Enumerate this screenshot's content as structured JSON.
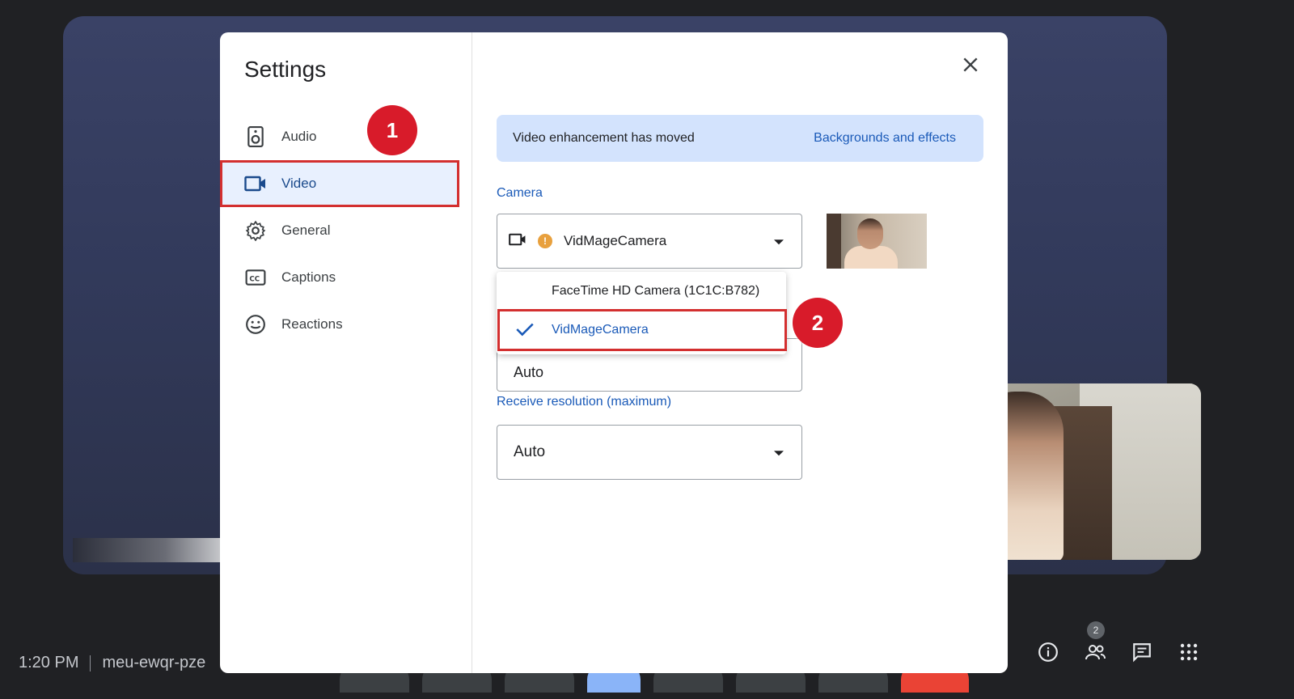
{
  "meeting": {
    "time": "1:20 PM",
    "code": "meu-ewqr-pze",
    "participant_count": "2"
  },
  "settings": {
    "title": "Settings",
    "close_icon": "close-icon",
    "nav": [
      {
        "label": "Audio",
        "icon": "speaker-icon"
      },
      {
        "label": "Video",
        "icon": "video-camera-icon",
        "active": true
      },
      {
        "label": "General",
        "icon": "gear-icon"
      },
      {
        "label": "Captions",
        "icon": "captions-icon"
      },
      {
        "label": "Reactions",
        "icon": "smiley-icon"
      }
    ],
    "banner": {
      "message": "Video enhancement has moved",
      "link": "Backgrounds and effects"
    },
    "camera": {
      "label": "Camera",
      "selected": "VidMageCamera",
      "options": [
        {
          "label": "FaceTime HD Camera (1C1C:B782)",
          "checked": false
        },
        {
          "label": "VidMageCamera",
          "checked": true
        }
      ]
    },
    "send_resolution": {
      "value": "Auto"
    },
    "receive_resolution": {
      "label": "Receive resolution (maximum)",
      "value": "Auto"
    }
  },
  "annotations": {
    "step1": "1",
    "step2": "2"
  },
  "colors": {
    "accent": "#1a5ab8",
    "annotation_red": "#d32f2f",
    "banner_bg": "#d3e3fd",
    "warning": "#e8a03d"
  }
}
